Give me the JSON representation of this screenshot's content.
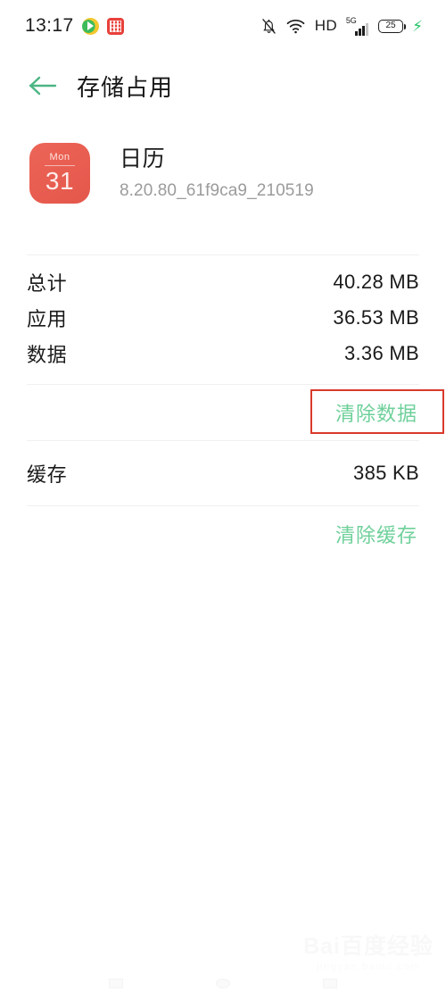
{
  "status_bar": {
    "time": "13:17",
    "left_icons": [
      "play-store-icon",
      "red-app-icon"
    ],
    "right_icons": [
      "bell-off-icon",
      "wifi-icon",
      "signal-5g-icon",
      "battery-icon",
      "charging-bolt-icon"
    ],
    "hd_label": "HD",
    "network_label": "5G",
    "battery_percent": "25",
    "bolt_glyph": "⚡"
  },
  "app_bar": {
    "back_icon": "arrow-left-icon",
    "title": "存储占用"
  },
  "app_header": {
    "icon_weekday": "Mon",
    "icon_day": "31",
    "name": "日历",
    "version": "8.20.80_61f9ca9_210519"
  },
  "storage_rows": [
    {
      "label": "总计",
      "value": "40.28 MB"
    },
    {
      "label": "应用",
      "value": "36.53 MB"
    },
    {
      "label": "数据",
      "value": "3.36 MB"
    }
  ],
  "cache_row": {
    "label": "缓存",
    "value": "385 KB"
  },
  "actions": {
    "clear_data": "清除数据",
    "clear_cache": "清除缓存"
  },
  "annotation": {
    "target": "clear-data-button",
    "color": "#d93a2b"
  },
  "watermark": {
    "main": "Bai百度经验",
    "sub": "jingyan.baidu.com"
  },
  "nav_bar": {
    "items": [
      "recents-button",
      "home-button",
      "back-button"
    ]
  },
  "colors": {
    "accent_green": "#6ed09a",
    "app_icon_red": "#e4574b",
    "annotation_red": "#d93a2b",
    "text_primary": "#1a1a1a",
    "text_secondary": "#9b9b9b",
    "divider": "#f0f0f0"
  }
}
